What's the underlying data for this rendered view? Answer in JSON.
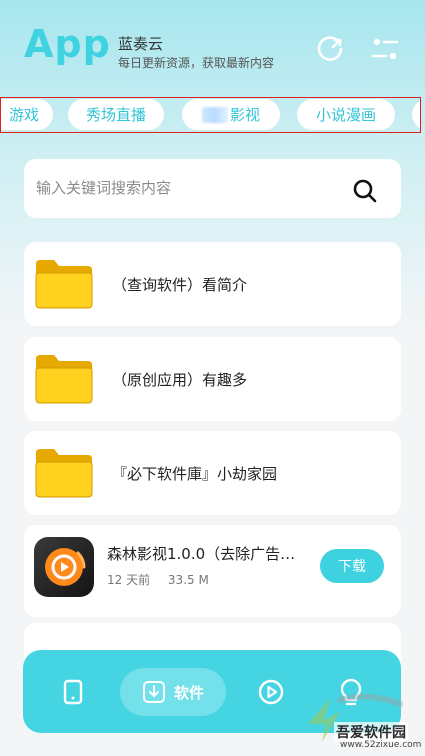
{
  "header": {
    "logo": "App",
    "name": "蓝奏云",
    "desc": "每日更新资源，获取最新内容",
    "icons": [
      "refresh-icon",
      "settings-icon"
    ]
  },
  "tabs": [
    {
      "label": "游戏"
    },
    {
      "label": "秀场直播"
    },
    {
      "label": "影视"
    },
    {
      "label": "小说漫画"
    },
    {
      "label": ""
    }
  ],
  "search": {
    "placeholder": "输入关键词搜索内容",
    "value": ""
  },
  "folders": [
    {
      "title": "（查询软件）看简介"
    },
    {
      "title": "（原创应用）有趣多"
    },
    {
      "title": "『必下软件庫』小劫家园"
    }
  ],
  "app_item": {
    "title": "森林影视1.0.0（去除广告…",
    "time": "12 天前",
    "size": "33.5 M",
    "download_label": "下载"
  },
  "bottom_nav": {
    "items": [
      "phone-icon",
      "download-icon",
      "play-icon",
      "bulb-icon"
    ],
    "active_label": "软件"
  },
  "watermark": {
    "site": "吾爱软件园",
    "url": "www.52zixue.com"
  },
  "colors": {
    "accent": "#3ed2e0",
    "tab_text": "#32c6d8",
    "highlight_border": "#e02020",
    "folder_yellow": "#ffd21f"
  }
}
